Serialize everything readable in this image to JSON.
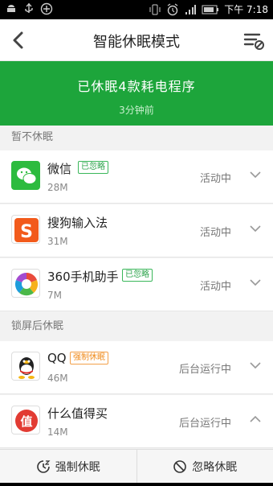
{
  "status_bar": {
    "time": "下午 7:18",
    "icons": [
      "android-icon",
      "usb-icon",
      "add-circle-icon",
      "vibrate-icon",
      "alarm-icon",
      "signal-icon",
      "battery-icon"
    ]
  },
  "title_bar": {
    "title": "智能休眠模式",
    "back_icon": "back-arrow-icon",
    "menu_icon": "filter-list-icon"
  },
  "banner": {
    "title": "已休眠4款耗电程序",
    "subtitle": "3分钟前",
    "color": "#1da53b"
  },
  "sections": [
    {
      "header": "暂不休眠",
      "apps": [
        {
          "name": "微信",
          "badge": "已忽略",
          "size": "28M",
          "status": "活动中",
          "chevron": "chevron-down-icon"
        },
        {
          "name": "搜狗输入法",
          "badge": "",
          "size": "31M",
          "status": "活动中",
          "chevron": "chevron-down-icon"
        },
        {
          "name": "360手机助手",
          "badge": "已忽略",
          "size": "7M",
          "status": "活动中",
          "chevron": "chevron-down-icon"
        }
      ]
    },
    {
      "header": "锁屏后休眠",
      "apps": [
        {
          "name": "QQ",
          "badge": "强制休眠",
          "size": "46M",
          "status": "后台运行中",
          "chevron": "chevron-down-icon"
        },
        {
          "name": "什么值得买",
          "badge": "",
          "size": "14M",
          "status": "后台运行中",
          "chevron": "chevron-up-icon"
        }
      ]
    }
  ],
  "bottom_bar": {
    "force_sleep": "强制休眠",
    "ignore_sleep": "忽略休眠"
  },
  "colors": {
    "badge_green": "#2aa34a",
    "badge_orange": "#f08a19"
  }
}
